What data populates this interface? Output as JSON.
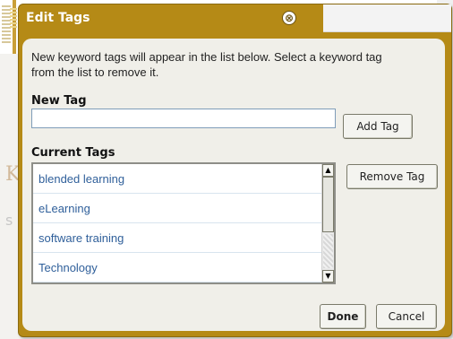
{
  "dialog": {
    "title": "Edit Tags",
    "close_symbol": "⊗",
    "description": "New keyword tags will appear in the list below. Select a keyword tag from the list to remove it.",
    "new_tag_label": "New Tag",
    "new_tag_value": "",
    "add_tag_label": "Add Tag",
    "current_tags_label": "Current Tags",
    "remove_tag_label": "Remove Tag",
    "done_label": "Done",
    "cancel_label": "Cancel",
    "tags": [
      "blended learning",
      "eLearning",
      "software training",
      "Technology"
    ]
  },
  "background": {
    "letter": "K",
    "letter2": "s"
  },
  "icons": {
    "close": "close-icon",
    "scroll_up": "scroll-up-arrow-icon",
    "scroll_down": "scroll-down-arrow-icon"
  },
  "colors": {
    "dialog_frame": "#b58a16",
    "panel_bg": "#f0efe9",
    "tag_text": "#2f5f9a"
  }
}
